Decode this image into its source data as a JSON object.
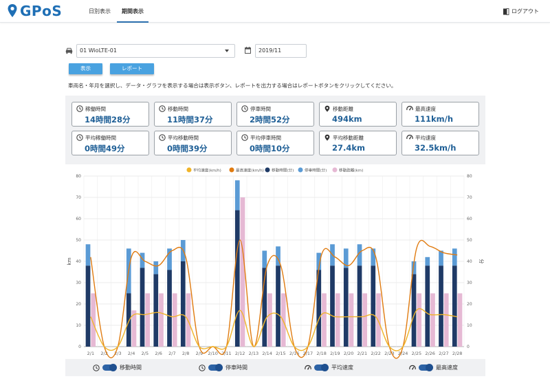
{
  "app": {
    "logo_text": "GPoS",
    "nav": [
      {
        "label": "日別表示",
        "active": false
      },
      {
        "label": "期間表示",
        "active": true
      }
    ],
    "logout_label": "ログアウト"
  },
  "controls": {
    "vehicle_value": "01 WioLTE-01",
    "month_value": "2019/11",
    "show_button": "表示",
    "report_button": "レポート",
    "instruction": "車両名・年月を選択し、データ・グラフを表示する場合は表示ボタン、レポートを出力する場合はレポートボタンをクリックしてください。"
  },
  "stats": [
    {
      "label": "稼働時間",
      "value": "14時間28分",
      "icon": "clock-icon"
    },
    {
      "label": "移動時間",
      "value": "11時間37分",
      "icon": "clock-icon"
    },
    {
      "label": "停車時間",
      "value": "2時間52分",
      "icon": "clock-icon"
    },
    {
      "label": "移動距離",
      "value": "494km",
      "icon": "map-pin-icon"
    },
    {
      "label": "最高速度",
      "value": "111km/h",
      "icon": "speedometer-icon"
    },
    {
      "label": "平均稼働時間",
      "value": "0時間49分",
      "icon": "clock-icon"
    },
    {
      "label": "平均移動時間",
      "value": "0時間39分",
      "icon": "clock-icon"
    },
    {
      "label": "平均停車時間",
      "value": "0時間10分",
      "icon": "clock-icon"
    },
    {
      "label": "平均移動距離",
      "value": "27.4km",
      "icon": "map-pin-icon"
    },
    {
      "label": "平均速度",
      "value": "32.5km/h",
      "icon": "speedometer-icon"
    }
  ],
  "chart_data": {
    "type": "bar",
    "categories": [
      "2/1",
      "2/2",
      "2/3",
      "2/4",
      "2/5",
      "2/6",
      "2/7",
      "2/8",
      "2/9",
      "2/10",
      "2/11",
      "2/12",
      "2/13",
      "2/14",
      "2/15",
      "2/16",
      "2/17",
      "2/18",
      "2/19",
      "2/20",
      "2/21",
      "2/22",
      "2/23",
      "2/24",
      "2/25",
      "2/26",
      "2/27",
      "2/28"
    ],
    "ylabel_left": "km",
    "ylabel_right": "分",
    "ylim": [
      0,
      80
    ],
    "yticks": [
      0,
      10,
      20,
      30,
      40,
      50,
      60,
      70,
      80
    ],
    "series": [
      {
        "name": "平均速度(km/h)",
        "kind": "line",
        "color": "#f0b429",
        "values": [
          14,
          0,
          0,
          14,
          15,
          16,
          14,
          14,
          0,
          0,
          0,
          17,
          0,
          14,
          14,
          0,
          0,
          15,
          14,
          14,
          14,
          14,
          0,
          0,
          17,
          15,
          15,
          14
        ]
      },
      {
        "name": "最高速度(km/h)",
        "kind": "line",
        "color": "#e07b10",
        "values": [
          42,
          0,
          0,
          42,
          40,
          38,
          45,
          42,
          0,
          0,
          0,
          50,
          0,
          38,
          38,
          0,
          0,
          43,
          42,
          38,
          45,
          42,
          0,
          0,
          46,
          47,
          44,
          43
        ]
      },
      {
        "name": "移動時間(分)",
        "kind": "stacked-bar",
        "color": "#1f3a66",
        "values": [
          38,
          0,
          0,
          25,
          37,
          34,
          36,
          40,
          0,
          0,
          0,
          64,
          0,
          37,
          38,
          0,
          0,
          36,
          38,
          37,
          38,
          38,
          0,
          0,
          34,
          38,
          38,
          38
        ]
      },
      {
        "name": "停車時間(分)",
        "kind": "stacked-bar",
        "color": "#5b9bd5",
        "values": [
          10,
          0,
          0,
          21,
          7,
          6,
          10,
          10,
          0,
          0,
          0,
          14,
          0,
          8,
          9,
          0,
          0,
          8,
          10,
          9,
          10,
          8,
          0,
          0,
          6,
          4,
          7,
          8
        ]
      },
      {
        "name": "移動距離(km)",
        "kind": "bar",
        "color": "#e6b9d4",
        "values": [
          25,
          0,
          0,
          17,
          25,
          25,
          25,
          25,
          0,
          0,
          0,
          70,
          0,
          25,
          25,
          0,
          0,
          25,
          25,
          25,
          25,
          25,
          0,
          0,
          25,
          25,
          25,
          25
        ]
      }
    ]
  },
  "toggles": [
    {
      "label": "移動時間",
      "icon": "clock-icon",
      "on": true
    },
    {
      "label": "停車時間",
      "icon": "clock-icon",
      "on": true
    },
    {
      "label": "平均速度",
      "icon": "speedometer-icon",
      "on": true
    },
    {
      "label": "最高速度",
      "icon": "speedometer-icon",
      "on": true
    }
  ]
}
